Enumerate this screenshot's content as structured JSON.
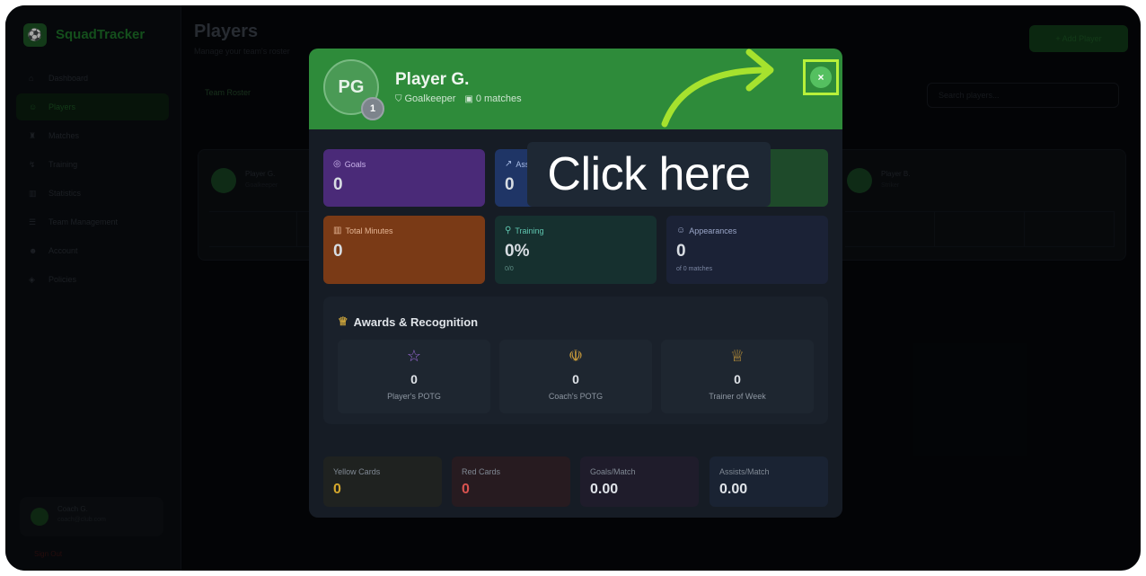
{
  "app": {
    "name": "SquadTracker",
    "logo_glyph": "⚽"
  },
  "sidebar": {
    "items": [
      {
        "label": "Dashboard",
        "icon": "home-icon",
        "glyph": "⌂",
        "active": false
      },
      {
        "label": "Players",
        "icon": "users-icon",
        "glyph": "☺",
        "active": true
      },
      {
        "label": "Matches",
        "icon": "trophy-icon",
        "glyph": "♜",
        "active": false
      },
      {
        "label": "Training",
        "icon": "dumbbell-icon",
        "glyph": "↯",
        "active": false
      },
      {
        "label": "Statistics",
        "icon": "chart-icon",
        "glyph": "▥",
        "active": false
      },
      {
        "label": "Team Management",
        "icon": "team-icon",
        "glyph": "☰",
        "active": false
      },
      {
        "label": "Account",
        "icon": "user-icon",
        "glyph": "☻",
        "active": false
      },
      {
        "label": "Policies",
        "icon": "shield-icon",
        "glyph": "◈",
        "active": false
      }
    ],
    "user": {
      "name": "Coach G.",
      "subtitle": "coach@club.com"
    },
    "logout": "Sign Out"
  },
  "page": {
    "title": "Players",
    "subtitle": "Manage your team's roster",
    "add_button": "+ Add Player",
    "roster_tab": "Team Roster",
    "search_placeholder": "Search players..."
  },
  "background_cards": [
    {
      "name": "Player G.",
      "sub": "Goalkeeper"
    },
    {
      "name": "Player B.",
      "sub": "Striker"
    }
  ],
  "modal": {
    "avatar_initials": "PG",
    "jersey_number": "1",
    "player_name": "Player G.",
    "position": "Goalkeeper",
    "matches": "0 matches",
    "close_glyph": "×",
    "stats": [
      {
        "label": "Goals",
        "value": "0",
        "foot": "",
        "icon": "target-icon",
        "glyph": "◎"
      },
      {
        "label": "Assists",
        "value": "0",
        "foot": "",
        "icon": "trend-icon",
        "glyph": "↗"
      },
      {
        "label": "Total Minutes",
        "value": "0",
        "foot": "",
        "icon": "bar-chart-icon",
        "glyph": "▥"
      },
      {
        "label": "Training",
        "value": "0%",
        "foot": "0/0",
        "icon": "dumbbell-icon",
        "glyph": "⚲"
      },
      {
        "label": "Appearances",
        "value": "0",
        "foot": "of 0 matches",
        "icon": "users-icon",
        "glyph": "☺"
      }
    ],
    "awards": {
      "title": "Awards & Recognition",
      "items": [
        {
          "label": "Player's POTG",
          "value": "0",
          "icon": "star-icon",
          "glyph": "☆",
          "color": "#9b6ad6"
        },
        {
          "label": "Coach's POTG",
          "value": "0",
          "icon": "medal-icon",
          "glyph": "☫",
          "color": "#c99a3a"
        },
        {
          "label": "Trainer of Week",
          "value": "0",
          "icon": "trophy-icon",
          "glyph": "♕",
          "color": "#c99a3a"
        }
      ]
    },
    "bottom_stats": [
      {
        "label": "Yellow Cards",
        "value": "0",
        "color": "#d4a72c"
      },
      {
        "label": "Red Cards",
        "value": "0",
        "color": "#d9534f"
      },
      {
        "label": "Goals/Match",
        "value": "0.00",
        "color": "#dfe3e8"
      },
      {
        "label": "Assists/Match",
        "value": "0.00",
        "color": "#dfe3e8"
      }
    ]
  },
  "tooltip": {
    "text": "Click here"
  },
  "colors": {
    "header_green": "#2e8b3a",
    "highlight": "#b7f03a",
    "goals_bg": "#4a2a78",
    "assists_bg": "#1f3566",
    "minutes_bg": "#7a3a16",
    "training_bg": "#16302f",
    "appearances_bg": "#1b2236"
  }
}
